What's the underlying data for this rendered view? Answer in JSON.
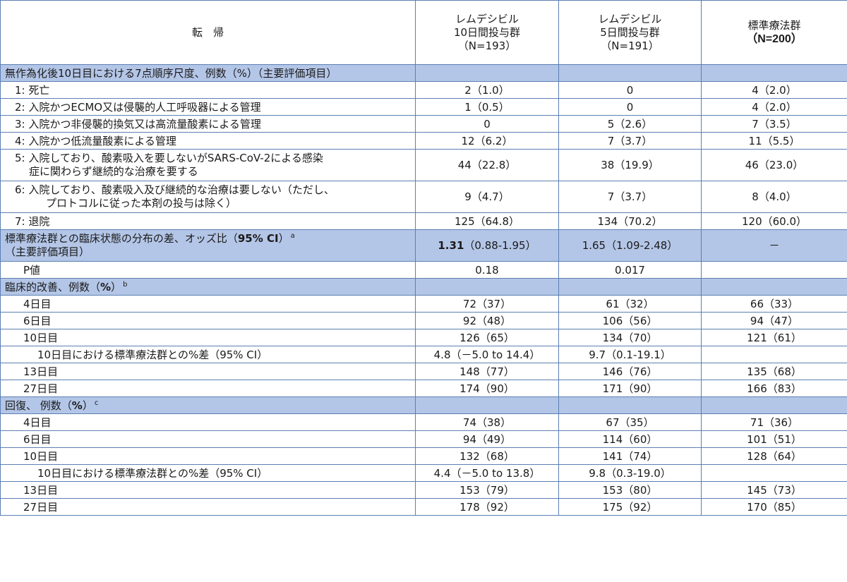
{
  "header": {
    "col0": "転　帰",
    "col1": [
      "レムデシビル",
      "10日間投与群",
      "（N=193）"
    ],
    "col2": [
      "レムデシビル",
      "5日間投与群",
      "（N=191）"
    ],
    "col3": [
      "標準療法群",
      "（N=200）"
    ]
  },
  "sections": {
    "ordinal": "無作為化後10日目における7点順序尺度、例数（%）（主要評価項目）",
    "odds_line1_pre": "標準療法群との臨床状態の分布の差、オッズ比（",
    "odds_line1_bold": "95% CI",
    "odds_line1_post": "）",
    "odds_sup": "a",
    "odds_line2": "（主要評価項目）",
    "clinical_pre": "臨床的改善、例数（",
    "clinical_bold": "%",
    "clinical_post": "）",
    "clinical_sup": "b",
    "recovery_pre": "回復、 例数（",
    "recovery_bold": "%",
    "recovery_post": "）",
    "recovery_sup": "c"
  },
  "ordinal_rows": [
    {
      "label": "1: 死亡",
      "v1": "2（1.0）",
      "v2": "0",
      "v3": "4（2.0）"
    },
    {
      "label": "2: 入院かつECMO又は侵襲的人工呼吸器による管理",
      "v1": "1（0.5）",
      "v2": "0",
      "v3": "4（2.0）"
    },
    {
      "label": "3: 入院かつ非侵襲的換気又は高流量酸素による管理",
      "v1": "0",
      "v2": "5（2.6）",
      "v3": "7（3.5）"
    },
    {
      "label": "4: 入院かつ低流量酸素による管理",
      "v1": "12（6.2）",
      "v2": "7（3.7）",
      "v3": "11（5.5）"
    },
    {
      "label_line1": "5: 入院しており、酸素吸入を要しないがSARS-CoV-2による感染",
      "label_line2": "症に関わらず継続的な治療を要する",
      "v1": "44（22.8）",
      "v2": "38（19.9）",
      "v3": "46（23.0）"
    },
    {
      "label_line1": "6: 入院しており、酸素吸入及び継続的な治療は要しない（ただし、",
      "label_line2": "プロトコルに従った本剤の投与は除く）",
      "v1": "9（4.7）",
      "v2": "7（3.7）",
      "v3": "8（4.0）"
    },
    {
      "label": "7: 退院",
      "v1": "125（64.8）",
      "v2": "134（70.2）",
      "v3": "120（60.0）"
    }
  ],
  "odds": {
    "v1_bold": "1.31",
    "v1_rest": "（0.88-1.95）",
    "v2": "1.65（1.09-2.48）",
    "v3": "－"
  },
  "pvalue": {
    "label": "P値",
    "v1": "0.18",
    "v2": "0.017",
    "v3": ""
  },
  "clinical_rows": [
    {
      "label": "4日目",
      "v1": "72（37）",
      "v2": "61（32）",
      "v3": "66（33）"
    },
    {
      "label": "6日目",
      "v1": "92（48）",
      "v2": "106（56）",
      "v3": "94（47）"
    },
    {
      "label": "10日目",
      "v1": "126（65）",
      "v2": "134（70）",
      "v3": "121（61）"
    },
    {
      "label": "10日目における標準療法群との%差（95% CI）",
      "v1": "4.8（－5.0 to 14.4）",
      "v2": "9.7（0.1-19.1）",
      "v3": ""
    },
    {
      "label": "13日目",
      "v1": "148（77）",
      "v2": "146（76）",
      "v3": "135（68）"
    },
    {
      "label": "27日目",
      "v1": "174（90）",
      "v2": "171（90）",
      "v3": "166（83）"
    }
  ],
  "recovery_rows": [
    {
      "label": "4日目",
      "v1": "74（38）",
      "v2": "67（35）",
      "v3": "71（36）"
    },
    {
      "label": "6日目",
      "v1": "94（49）",
      "v2": "114（60）",
      "v3": "101（51）"
    },
    {
      "label": "10日目",
      "v1": "132（68）",
      "v2": "141（74）",
      "v3": "128（64）"
    },
    {
      "label": "10日目における標準療法群との%差（95% CI）",
      "v1": "4.4（－5.0 to 13.8）",
      "v2": "9.8（0.3-19.0）",
      "v3": ""
    },
    {
      "label": "13日目",
      "v1": "153（79）",
      "v2": "153（80）",
      "v3": "145（73）"
    },
    {
      "label": "27日目",
      "v1": "178（92）",
      "v2": "175（92）",
      "v3": "170（85）"
    }
  ]
}
